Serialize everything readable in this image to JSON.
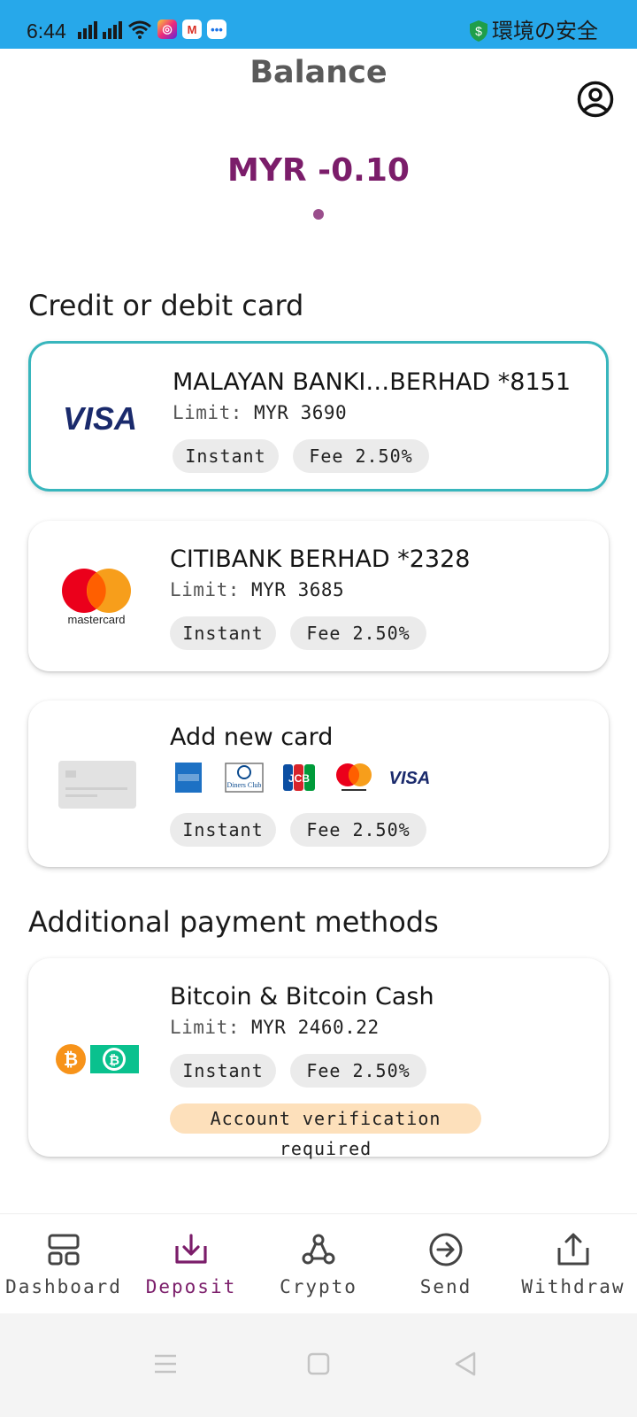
{
  "status_bar": {
    "time": "6:44",
    "right_text": "環境の安全",
    "bg_color": "#27a8ea"
  },
  "header": {
    "title": "Balance",
    "balance": "MYR -0.10",
    "accent_color": "#7b1d6a"
  },
  "sections": {
    "card_title": "Credit or debit card",
    "additional_title": "Additional payment methods"
  },
  "cards": [
    {
      "logo": "visa-logo",
      "name": "MALAYAN BANKI…BERHAD *8151",
      "limit_label": "Limit:",
      "limit_value": "MYR 3690",
      "speed": "Instant",
      "fee": "Fee 2.50%",
      "selected": true
    },
    {
      "logo": "mastercard-logo",
      "logo_text": "mastercard",
      "name": "CITIBANK BERHAD *2328",
      "limit_label": "Limit:",
      "limit_value": "MYR 3685",
      "speed": "Instant",
      "fee": "Fee 2.50%",
      "selected": false
    }
  ],
  "add_card": {
    "name": "Add new card",
    "speed": "Instant",
    "fee": "Fee 2.50%",
    "brands": [
      "amex-logo",
      "diners-club-logo",
      "jcb-logo",
      "mastercard-logo",
      "visa-logo"
    ],
    "diners_text": "Diners Club",
    "visa_text": "VISA",
    "jcb_text": "JCB"
  },
  "crypto_method": {
    "logo": "bitcoin-logos",
    "name": "Bitcoin & Bitcoin Cash",
    "limit_label": "Limit:",
    "limit_value": "MYR 2460.22",
    "speed": "Instant",
    "fee": "Fee 2.50%",
    "warning": "Account verification required"
  },
  "visa_text": "VISA",
  "bottom_nav": [
    {
      "label": "Dashboard",
      "icon": "dashboard-icon",
      "active": false
    },
    {
      "label": "Deposit",
      "icon": "deposit-icon",
      "active": true
    },
    {
      "label": "Crypto",
      "icon": "crypto-icon",
      "active": false
    },
    {
      "label": "Send",
      "icon": "send-icon",
      "active": false
    },
    {
      "label": "Withdraw",
      "icon": "withdraw-icon",
      "active": false
    }
  ]
}
